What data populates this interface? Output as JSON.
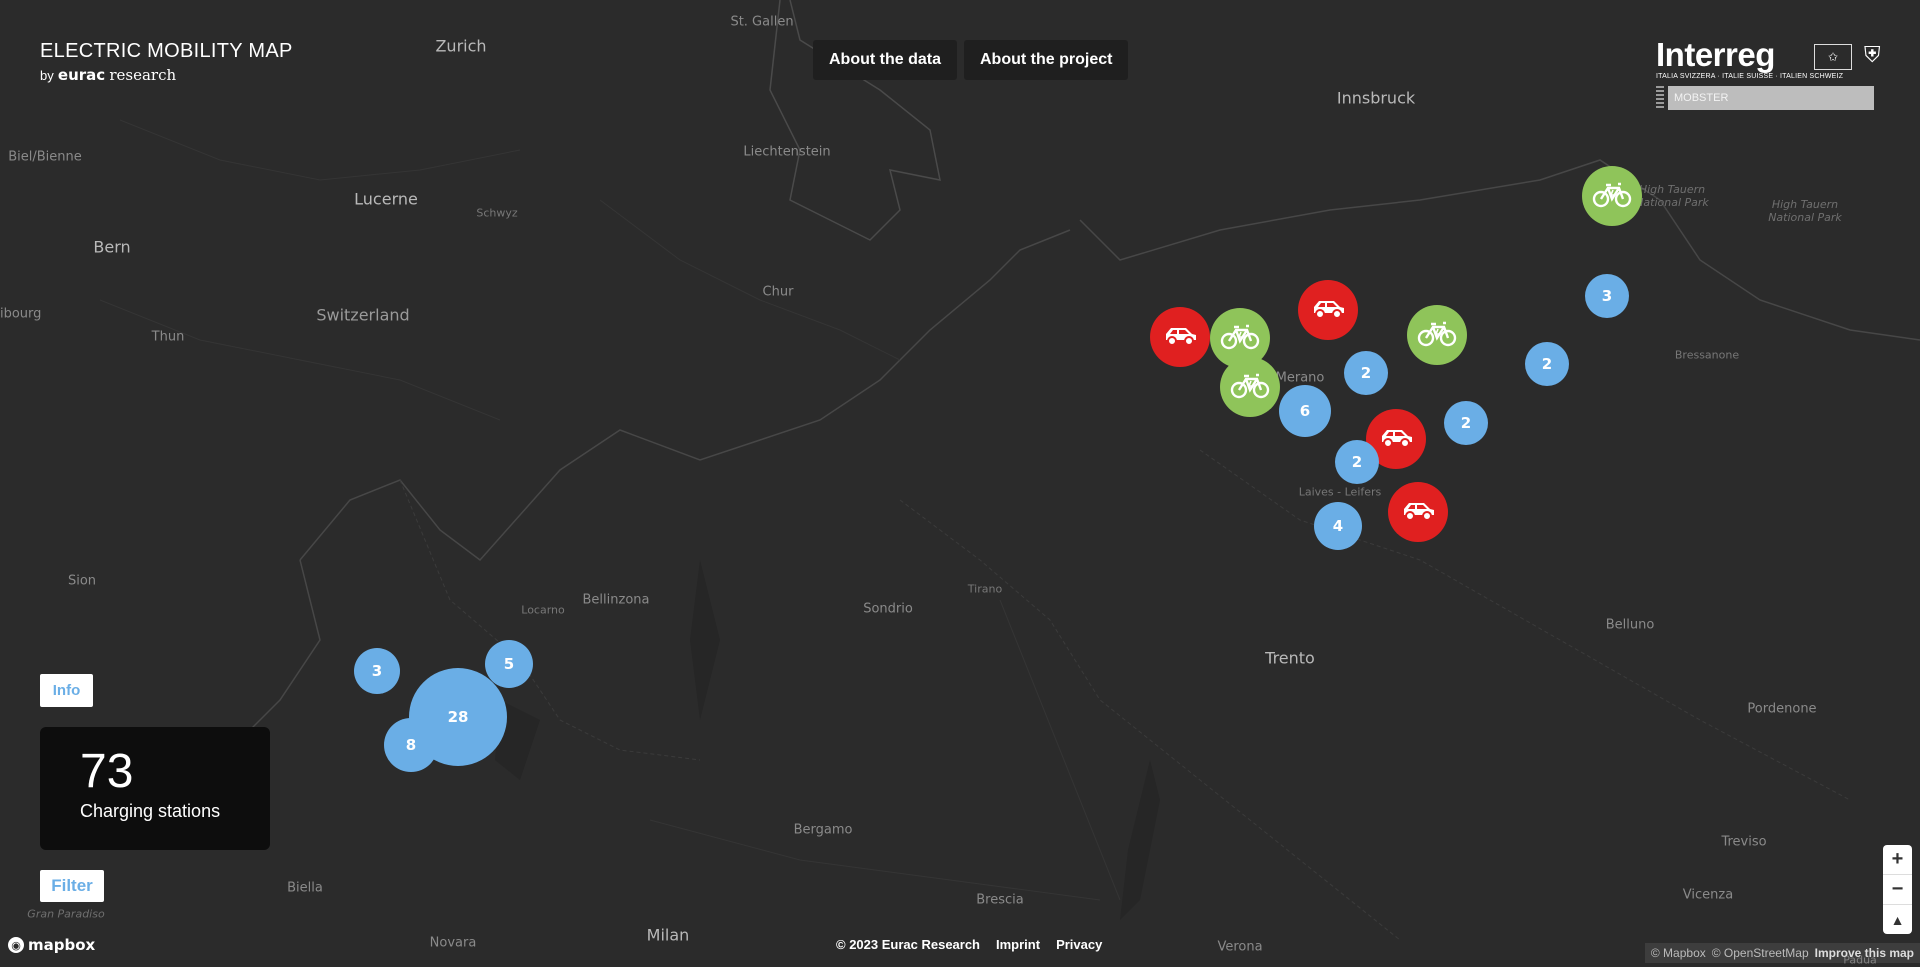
{
  "brand": {
    "title": "ELECTRIC MOBILITY MAP",
    "by": "by",
    "org_bold": "eurac",
    "org_light": "research"
  },
  "nav": {
    "about_data": "About the data",
    "about_project": "About the project"
  },
  "partner": {
    "logo_text": "Interreg",
    "tagline": "ITALIA SVIZZERA · ITALIE SUISSE · ITALIEN SCHWEIZ",
    "project": "MOBSTER"
  },
  "info_tab": "Info",
  "stats": {
    "count": "73",
    "label": "Charging stations"
  },
  "filter_tab": "Filter",
  "mapbox": "mapbox",
  "footer": {
    "copyright": "© 2023 Eurac Research",
    "imprint": "Imprint",
    "privacy": "Privacy"
  },
  "attribution": {
    "mapbox": "© Mapbox",
    "osm": "© OpenStreetMap",
    "improve": "Improve this map"
  },
  "zoom": {
    "in": "+",
    "out": "−",
    "compass": "▲"
  },
  "places": [
    {
      "name": "St. Gallen",
      "type": "town"
    },
    {
      "name": "Zurich",
      "type": "city"
    },
    {
      "name": "Liechtenstein",
      "type": "town"
    },
    {
      "name": "Innsbruck",
      "type": "city"
    },
    {
      "name": "Biel/Bienne",
      "type": "town"
    },
    {
      "name": "Lucerne",
      "type": "city"
    },
    {
      "name": "Schwyz",
      "type": "small"
    },
    {
      "name": "Bern",
      "type": "city"
    },
    {
      "name": "Chur",
      "type": "town"
    },
    {
      "name": "Switzerland",
      "type": "region"
    },
    {
      "name": "ribourg",
      "type": "town"
    },
    {
      "name": "Thun",
      "type": "town"
    },
    {
      "name": "Merano",
      "type": "town"
    },
    {
      "name": "Laives - Leifers",
      "type": "small"
    },
    {
      "name": "Sion",
      "type": "town"
    },
    {
      "name": "Locarno",
      "type": "small"
    },
    {
      "name": "Bellinzona",
      "type": "town"
    },
    {
      "name": "Sondrio",
      "type": "town"
    },
    {
      "name": "Tirano",
      "type": "small"
    },
    {
      "name": "Trento",
      "type": "city"
    },
    {
      "name": "Belluno",
      "type": "town"
    },
    {
      "name": "Pordenone",
      "type": "town"
    },
    {
      "name": "Bergamo",
      "type": "town"
    },
    {
      "name": "Biella",
      "type": "town"
    },
    {
      "name": "Gran Paradiso",
      "type": "park"
    },
    {
      "name": "Brescia",
      "type": "town"
    },
    {
      "name": "Vicenza",
      "type": "town"
    },
    {
      "name": "Treviso",
      "type": "town"
    },
    {
      "name": "Milan",
      "type": "city"
    },
    {
      "name": "Novara",
      "type": "town"
    },
    {
      "name": "Verona",
      "type": "town"
    },
    {
      "name": "Padua",
      "type": "small"
    },
    {
      "name": "High Tauern National Park",
      "type": "park"
    },
    {
      "name": "High Tauern National Park",
      "type": "park"
    },
    {
      "name": "Bressanone",
      "type": "small"
    }
  ],
  "markers": [
    {
      "kind": "bike"
    },
    {
      "kind": "cluster",
      "count": "3"
    },
    {
      "kind": "car"
    },
    {
      "kind": "bike"
    },
    {
      "kind": "car"
    },
    {
      "kind": "bike"
    },
    {
      "kind": "bike"
    },
    {
      "kind": "cluster",
      "count": "2"
    },
    {
      "kind": "cluster",
      "count": "2"
    },
    {
      "kind": "cluster",
      "count": "6"
    },
    {
      "kind": "car"
    },
    {
      "kind": "cluster",
      "count": "2"
    },
    {
      "kind": "cluster",
      "count": "2"
    },
    {
      "kind": "car"
    },
    {
      "kind": "cluster",
      "count": "4"
    },
    {
      "kind": "cluster",
      "count": "3"
    },
    {
      "kind": "cluster",
      "count": "5"
    },
    {
      "kind": "cluster",
      "count": "28"
    },
    {
      "kind": "cluster",
      "count": "8"
    }
  ]
}
